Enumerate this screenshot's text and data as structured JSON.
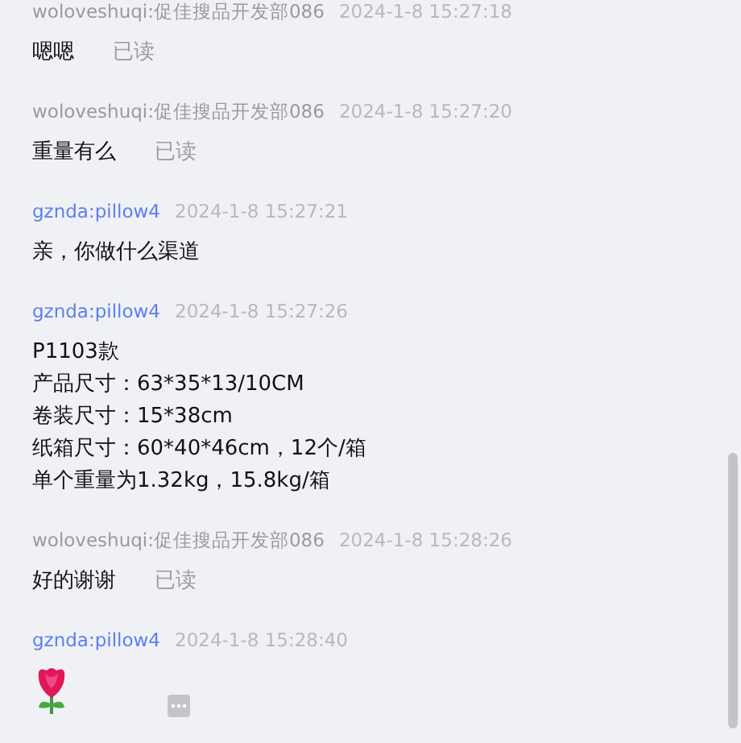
{
  "messages": [
    {
      "from_self": true,
      "sender": "woloveshuqi:促佳搜品开发部086",
      "time": "2024-1-8 15:27:18",
      "kind": "text",
      "lines": [
        "嗯嗯"
      ],
      "status": "已读"
    },
    {
      "from_self": true,
      "sender": "woloveshuqi:促佳搜品开发部086",
      "time": "2024-1-8 15:27:20",
      "kind": "text",
      "lines": [
        "重量有么"
      ],
      "status": "已读"
    },
    {
      "from_self": false,
      "sender": "gznda:pillow4",
      "time": "2024-1-8 15:27:21",
      "kind": "text",
      "lines": [
        "亲，你做什么渠道"
      ]
    },
    {
      "from_self": false,
      "sender": "gznda:pillow4",
      "time": "2024-1-8 15:27:26",
      "kind": "text",
      "lines": [
        "P1103款",
        "产品尺寸：63*35*13/10CM",
        "卷装尺寸：15*38cm",
        "纸箱尺寸：60*40*46cm，12个/箱",
        "单个重量为1.32kg，15.8kg/箱"
      ]
    },
    {
      "from_self": true,
      "sender": "woloveshuqi:促佳搜品开发部086",
      "time": "2024-1-8 15:28:26",
      "kind": "text",
      "lines": [
        "好的谢谢"
      ],
      "status": "已读"
    },
    {
      "from_self": false,
      "sender": "gznda:pillow4",
      "time": "2024-1-8 15:28:40",
      "kind": "sticker"
    }
  ]
}
